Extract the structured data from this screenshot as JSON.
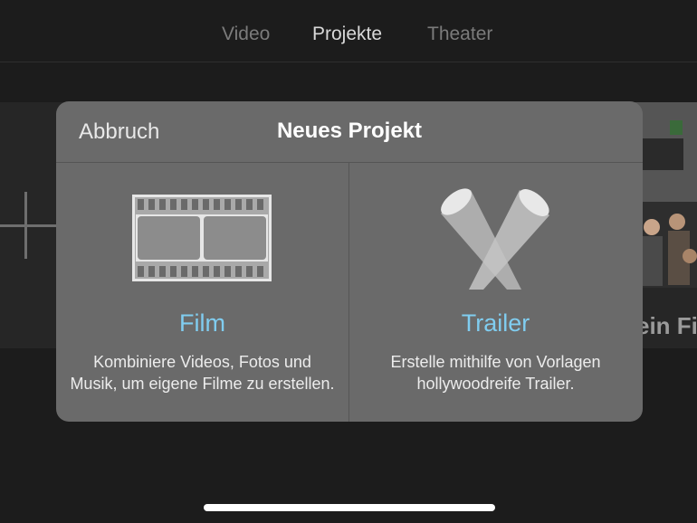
{
  "tabs": [
    {
      "label": "Video",
      "active": false
    },
    {
      "label": "Projekte",
      "active": true
    },
    {
      "label": "Theater",
      "active": false
    }
  ],
  "background": {
    "photo_caption": "ein Fi"
  },
  "dialog": {
    "cancel_label": "Abbruch",
    "title": "Neues Projekt",
    "options": [
      {
        "label": "Film",
        "icon": "film-strip-icon",
        "description": "Kombiniere Videos, Fotos und Musik, um eigene Filme zu erstellen."
      },
      {
        "label": "Trailer",
        "icon": "spotlights-icon",
        "description": "Erstelle mithilfe von Vorlagen hollywoodreife Trailer."
      }
    ]
  },
  "colors": {
    "accent": "#80cdf0",
    "dialog_bg": "#6a6a6a",
    "app_bg": "#1c1c1c"
  }
}
